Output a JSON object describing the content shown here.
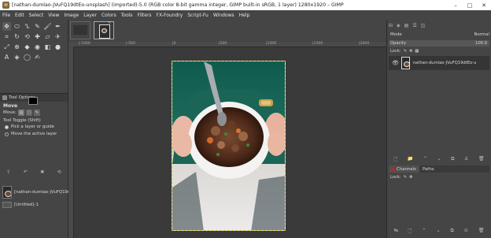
{
  "window": {
    "title": "[nathan-dumlao-JVuFQ19dtEo-unsplash] (imported)-5.0 (RGB color 8-bit gamma integer, GIMP built-in sRGB, 1 layer) 1280x1920 – GIMP",
    "minimize": "–",
    "maximize": "□",
    "close": "✕"
  },
  "menu": [
    "File",
    "Edit",
    "Select",
    "View",
    "Image",
    "Layer",
    "Colors",
    "Tools",
    "Filters",
    "FX-Foundry",
    "Script-Fu",
    "Windows",
    "Help"
  ],
  "toolbox": {
    "tools": [
      {
        "name": "move-tool-icon",
        "glyph": "✥",
        "active": true
      },
      {
        "name": "ellipse-select-icon",
        "glyph": "⬭"
      },
      {
        "name": "free-select-icon",
        "glyph": "ᔐ"
      },
      {
        "name": "fuzzy-select-icon",
        "glyph": "✎"
      },
      {
        "name": "paintbrush-icon",
        "glyph": "🖌"
      },
      {
        "name": "ink-icon",
        "glyph": "✒"
      },
      {
        "name": "crop-icon",
        "glyph": "⌗"
      },
      {
        "name": "rotate-icon",
        "glyph": "↻"
      },
      {
        "name": "warp-icon",
        "glyph": "⟲"
      },
      {
        "name": "heal-icon",
        "glyph": "✚"
      },
      {
        "name": "eraser-icon",
        "glyph": "▱"
      },
      {
        "name": "airbrush-icon",
        "glyph": "✈"
      },
      {
        "name": "scale-icon",
        "glyph": "⤢"
      },
      {
        "name": "clone-icon",
        "glyph": "⊕"
      },
      {
        "name": "bucket-fill-icon",
        "glyph": "◆"
      },
      {
        "name": "smudge-icon",
        "glyph": "◉"
      },
      {
        "name": "blend-icon",
        "glyph": "◧"
      },
      {
        "name": "dodge-icon",
        "glyph": "●"
      },
      {
        "name": "text-icon",
        "glyph": "A"
      },
      {
        "name": "color-picker-icon",
        "glyph": "◈"
      },
      {
        "name": "measure-icon",
        "glyph": "◯"
      },
      {
        "name": "path-icon",
        "glyph": "✍"
      }
    ],
    "foreground_color": "#000000",
    "background_color": "#e8141a"
  },
  "tool_options": {
    "tab_label": "Tool Options",
    "title": "Move",
    "move_label": "Move:",
    "toggle_label": "Tool Toggle  (Shift)",
    "options": [
      "Pick a layer or guide",
      "Move the active layer"
    ],
    "bottom_icons": [
      "⇪",
      "↶",
      "✖",
      "⟲"
    ]
  },
  "images_panel": {
    "rows": [
      "[nathan-dumlao-JVuFQ19dtE",
      "[Untitled]-1"
    ]
  },
  "image_tabs": {
    "close": "✕"
  },
  "ruler": {
    "labels": [
      "|-1000",
      "|-500",
      "|0",
      "|500",
      "|1000",
      "|1500",
      "|2000"
    ]
  },
  "right_dock": {
    "top_icons": [
      "⊟",
      "◈",
      "▤",
      "☰",
      "◫"
    ],
    "mode_label": "Mode",
    "mode_value": "Normal",
    "opacity_label": "Opacity",
    "opacity_value": "100.0",
    "lock_label": "Lock:",
    "layer_name": "nathan-dumlao-JVuFQ19dtEo-u",
    "layer_icons": [
      "🗋",
      "📁",
      "⌃",
      "⌄",
      "⧉",
      "⚓",
      "🗑"
    ],
    "tabs": [
      "Channels",
      "Paths"
    ],
    "lock2_label": "Lock:",
    "bottom_icons": [
      "↹",
      "🗋",
      "⌃",
      "⌄",
      "⧉",
      "⊙",
      "🗑"
    ]
  }
}
